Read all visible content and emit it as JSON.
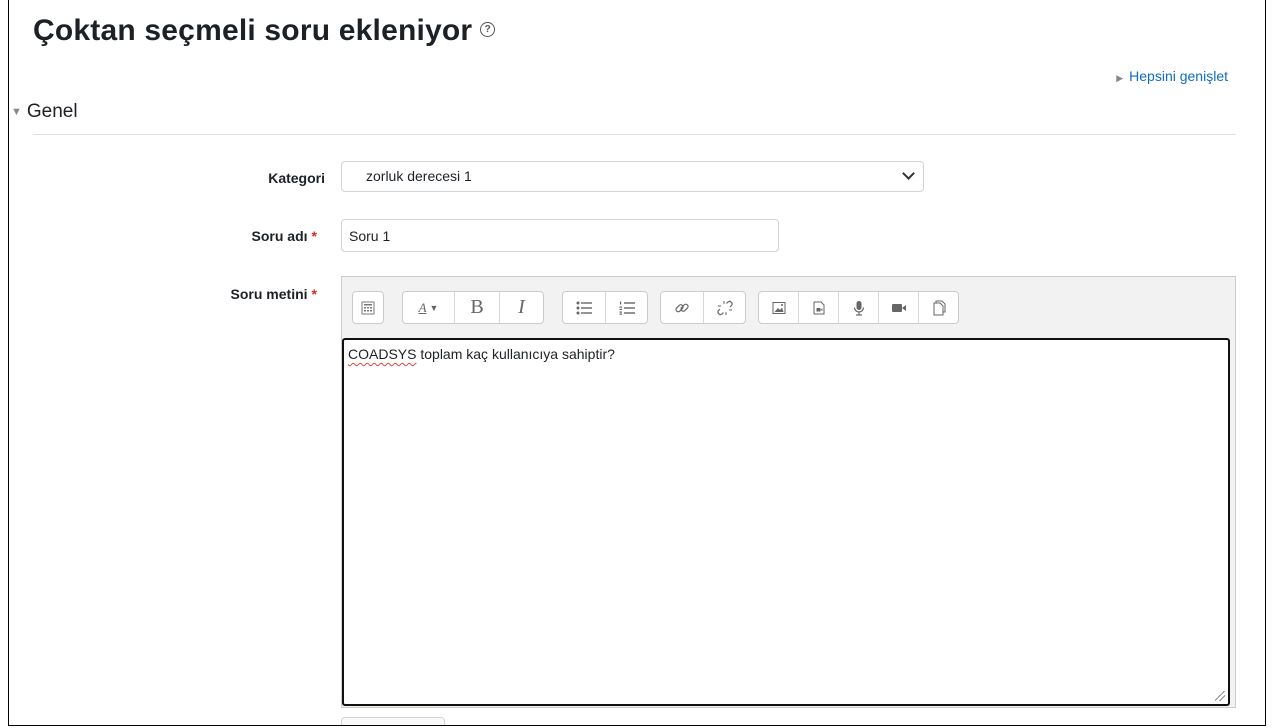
{
  "page": {
    "title": "Çoktan seçmeli soru ekleniyor",
    "help_icon": "?",
    "expand_all_label": "Hepsini genişlet"
  },
  "section": {
    "title": "Genel"
  },
  "form": {
    "category": {
      "label": "Kategori",
      "selected": "zorluk derecesi 1"
    },
    "question_name": {
      "label": "Soru adı",
      "required_marker": "*",
      "value": "Soru 1"
    },
    "question_text": {
      "label": "Soru metini",
      "required_marker": "*",
      "misspelled_word": "COADSYS",
      "rest_text": " toplam kaç kullanıcıya sahiptir?"
    }
  },
  "toolbar": {
    "icons": [
      "toolbar-toggle-icon",
      "font-style-icon",
      "bold-icon",
      "italic-icon",
      "unordered-list-icon",
      "ordered-list-icon",
      "link-icon",
      "unlink-icon",
      "image-icon",
      "media-icon",
      "record-audio-icon",
      "record-video-icon",
      "manage-files-icon"
    ],
    "bold_glyph": "B",
    "italic_glyph": "I",
    "font_glyph": "A"
  },
  "colors": {
    "link": "#0f6cbf",
    "required": "#ca3120",
    "editor_border": "#111111"
  }
}
